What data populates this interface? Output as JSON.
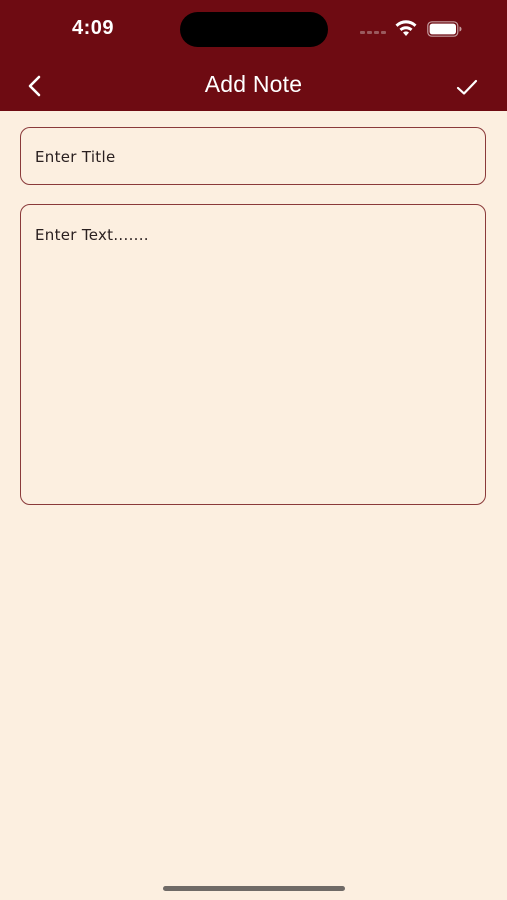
{
  "status_bar": {
    "time": "4:09"
  },
  "nav_bar": {
    "title": "Add Note",
    "back_icon": "chevron-left-icon",
    "confirm_icon": "checkmark-icon"
  },
  "form": {
    "title_field": {
      "value": "",
      "placeholder": "Enter Title"
    },
    "text_field": {
      "value": "",
      "placeholder": "Enter Text......."
    }
  },
  "colors": {
    "header_bg": "#6e0b12",
    "page_bg": "#fcefe0",
    "field_border": "#8a3a3a"
  }
}
